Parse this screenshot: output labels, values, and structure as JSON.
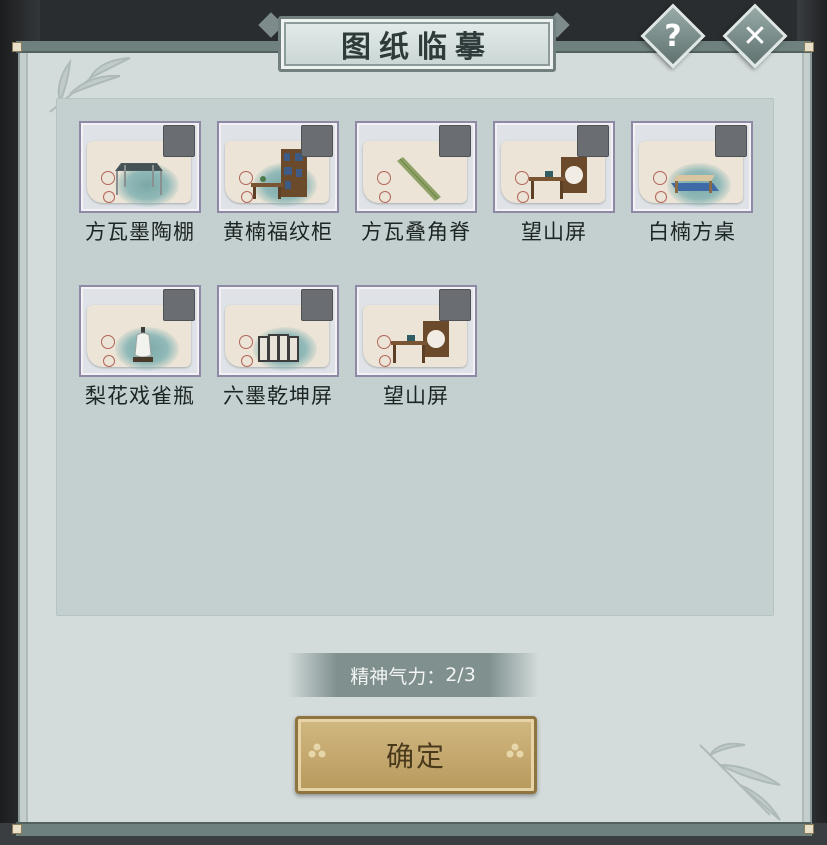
{
  "title": "图纸临摹",
  "help_glyph": "?",
  "close_glyph": "✕",
  "items": [
    {
      "name": "方瓦墨陶棚",
      "icon": "pergola-icon"
    },
    {
      "name": "黄楠福纹柜",
      "icon": "cabinet-icon"
    },
    {
      "name": "方瓦叠角脊",
      "icon": "ridge-tile-icon"
    },
    {
      "name": "望山屏",
      "icon": "desk-screen-icon"
    },
    {
      "name": "白楠方桌",
      "icon": "square-table-icon"
    },
    {
      "name": "梨花戏雀瓶",
      "icon": "vase-icon"
    },
    {
      "name": "六墨乾坤屏",
      "icon": "folding-screen-icon"
    },
    {
      "name": "望山屏",
      "icon": "desk-screen-icon"
    }
  ],
  "spirit": {
    "label": "精神气力：",
    "value": "2/3"
  },
  "confirm_label": "确定",
  "colors": {
    "panel": "#d3dcdb",
    "inner": "#c3d0cf",
    "button_gold": "#c5aa70",
    "frame": "#6f817f"
  }
}
